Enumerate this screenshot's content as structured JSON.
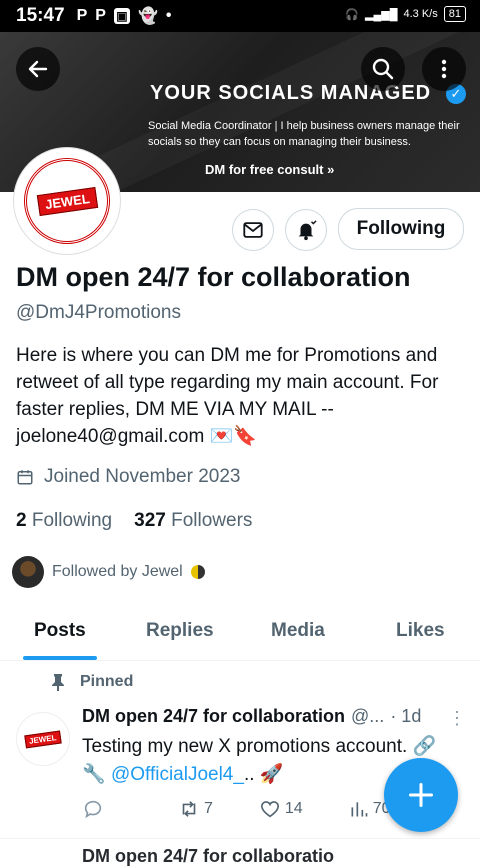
{
  "status_bar": {
    "time": "15:47",
    "net_speed": "4.3 K/s",
    "battery": "81"
  },
  "banner": {
    "headline": "YOUR SOCIALS MANAGED",
    "subtitle": "Social Media Coordinator | I help business owners manage their socials so they can focus on managing their business.",
    "cta": "DM for free consult"
  },
  "avatar_text": "JEWEL",
  "following_button": "Following",
  "profile": {
    "name": "DM open 24/7 for collaboration",
    "handle": "@DmJ4Promotions",
    "bio": "Here is where you can DM me for Promotions and retweet of all type regarding my main account.  For faster replies, DM ME VIA MY MAIL -- joelone40@gmail.com 💌🔖",
    "joined": "Joined November 2023",
    "following_count": "2",
    "following_label": "Following",
    "followers_count": "327",
    "followers_label": "Followers",
    "followed_by": "Followed by Jewel"
  },
  "tabs": [
    "Posts",
    "Replies",
    "Media",
    "Likes"
  ],
  "pinned_label": "Pinned",
  "tweet": {
    "author": "DM open 24/7 for collaboration",
    "handle": "@...",
    "time": "· 1d",
    "text": "Testing my new X promotions account. 🔗",
    "link_prefix": "🔧 ",
    "link": "@OfficialJoel4_",
    "link_suffix": ".. 🚀",
    "retweets": "7",
    "likes": "14",
    "views": "70"
  },
  "next_tweet_peek": "DM open 24/7 for collaboratio"
}
